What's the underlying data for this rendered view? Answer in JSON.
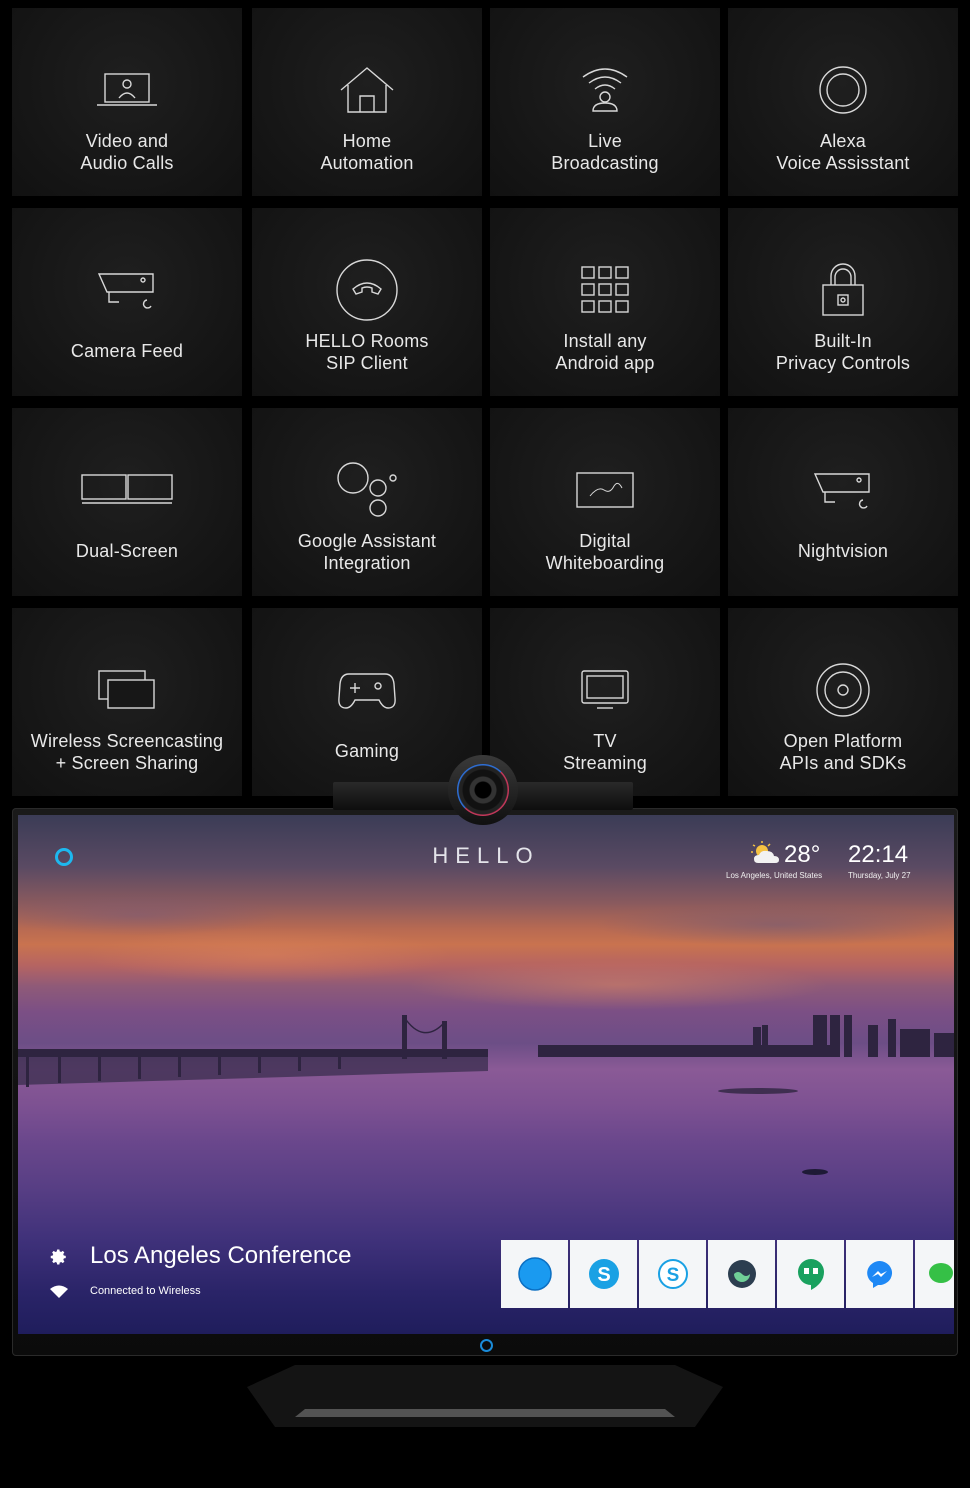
{
  "features": [
    {
      "id": "video-audio-calls",
      "lines": [
        "Video and",
        "Audio Calls"
      ],
      "icon": "laptop-user-icon"
    },
    {
      "id": "home-automation",
      "lines": [
        "Home",
        "Automation"
      ],
      "icon": "house-icon"
    },
    {
      "id": "live-broadcasting",
      "lines": [
        "Live",
        "Broadcasting"
      ],
      "icon": "broadcast-person-icon"
    },
    {
      "id": "alexa-voice",
      "lines": [
        "Alexa",
        "Voice Assisstant"
      ],
      "icon": "alexa-ring-icon"
    },
    {
      "id": "camera-feed",
      "lines": [
        "Camera Feed"
      ],
      "icon": "security-camera-icon"
    },
    {
      "id": "hello-rooms-sip",
      "lines": [
        "HELLO Rooms",
        "SIP Client"
      ],
      "icon": "phone-circle-icon"
    },
    {
      "id": "install-android",
      "lines": [
        "Install any",
        "Android app"
      ],
      "icon": "app-grid-icon"
    },
    {
      "id": "privacy-controls",
      "lines": [
        "Built-In",
        "Privacy Controls"
      ],
      "icon": "padlock-icon"
    },
    {
      "id": "dual-screen",
      "lines": [
        "Dual-Screen"
      ],
      "icon": "two-monitors-icon"
    },
    {
      "id": "google-assistant",
      "lines": [
        "Google Assistant",
        "Integration"
      ],
      "icon": "google-assistant-dots-icon"
    },
    {
      "id": "digital-whiteboarding",
      "lines": [
        "Digital",
        "Whiteboarding"
      ],
      "icon": "whiteboard-icon"
    },
    {
      "id": "nightvision",
      "lines": [
        "Nightvision"
      ],
      "icon": "night-camera-icon"
    },
    {
      "id": "wireless-screencasting",
      "lines": [
        "Wireless Screencasting",
        "+ Screen Sharing"
      ],
      "icon": "stacked-screens-icon"
    },
    {
      "id": "gaming",
      "lines": [
        "Gaming"
      ],
      "icon": "gamepad-icon"
    },
    {
      "id": "tv-streaming",
      "lines": [
        "TV",
        "Streaming"
      ],
      "icon": "tv-icon"
    },
    {
      "id": "open-platform",
      "lines": [
        "Open Platform",
        "APIs and SDKs"
      ],
      "icon": "disc-target-icon"
    }
  ],
  "tv": {
    "brand": "HELLO",
    "weather": {
      "temp": "28°",
      "location": "Los Angeles, United States",
      "icon": "partly-sunny-icon"
    },
    "clock": {
      "time": "22:14",
      "date": "Thursday, July 27"
    },
    "room_name": "Los Angeles Conference",
    "connection_status": "Connected to Wireless",
    "dock_apps": [
      "alexa-app-icon",
      "skype-app-icon",
      "skype-business-app-icon",
      "app-shield-icon",
      "hangouts-app-icon",
      "messenger-app-icon",
      "wechat-app-icon"
    ]
  },
  "colors": {
    "tile_bg": "#181818",
    "accent": "#1db8ef",
    "screen_top": "#3b3c56",
    "screen_bottom": "#1f1d5c"
  }
}
